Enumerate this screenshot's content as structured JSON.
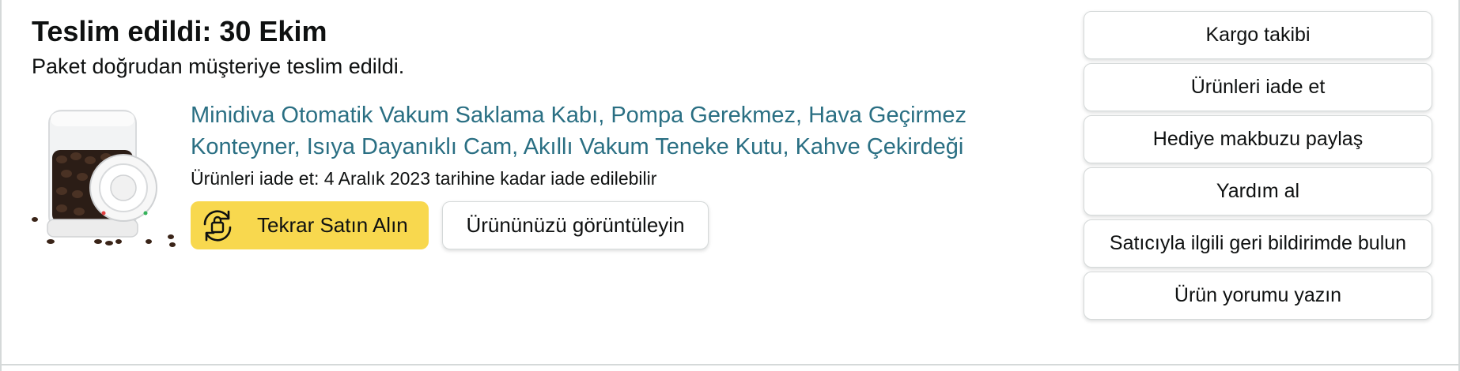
{
  "delivery": {
    "status_title": "Teslim edildi: 30 Ekim",
    "status_subtitle": "Paket doğrudan müşteriye teslim edildi."
  },
  "product": {
    "title_line1": "Minidiva Otomatik Vakum Saklama Kabı, Pompa Gerekmez, Hava Geçirmez",
    "title_line2": "Konteyner, Isıya Dayanıklı Cam, Akıllı Vakum Teneke Kutu, Kahve Çekirdeği",
    "return_info": "Ürünleri iade et: 4 Aralık 2023 tarihine kadar iade edilebilir",
    "image_icon": "coffee-vacuum-container-image",
    "link_color": "#2a6f83"
  },
  "buttons": {
    "buy_again_label": "Tekrar Satın Alın",
    "buy_again_icon": "reorder-cycle-icon",
    "buy_again_color": "#f8d84e",
    "view_item_label": "Ürününüzü görüntüleyin"
  },
  "actions": [
    {
      "label": "Kargo takibi"
    },
    {
      "label": "Ürünleri iade et"
    },
    {
      "label": "Hediye makbuzu paylaş"
    },
    {
      "label": "Yardım al"
    },
    {
      "label": "Satıcıyla ilgili geri bildirimde bulun"
    },
    {
      "label": "Ürün yorumu yazın"
    }
  ]
}
